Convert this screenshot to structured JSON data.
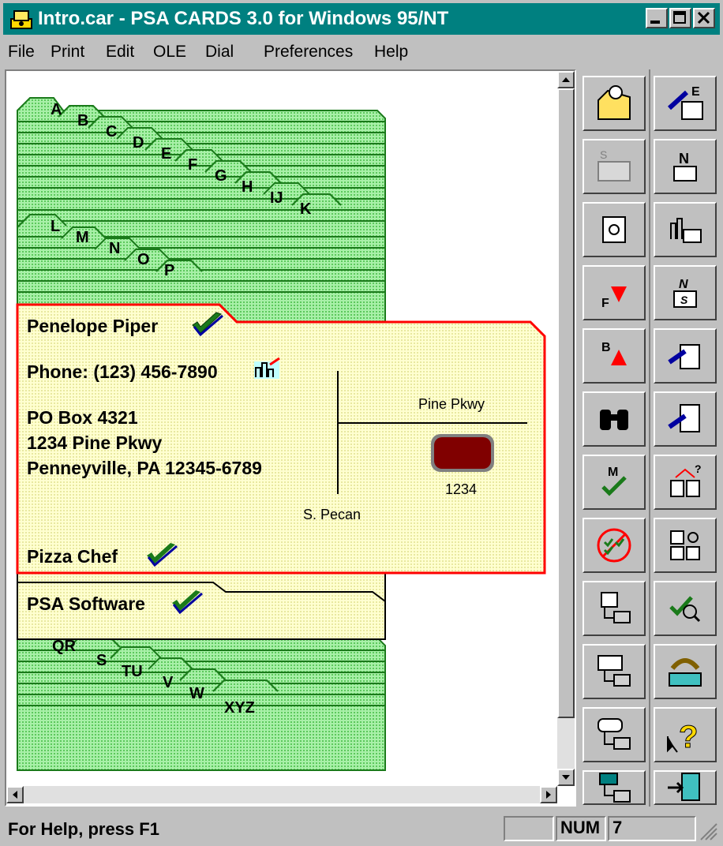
{
  "window": {
    "title": "Intro.car - PSA CARDS 3.0 for Windows 95/NT"
  },
  "menu": [
    {
      "label": "File"
    },
    {
      "label": "Print"
    },
    {
      "label": "Edit"
    },
    {
      "label": "OLE"
    },
    {
      "label": "Dial"
    },
    {
      "label": "Preferences"
    },
    {
      "label": "Help"
    }
  ],
  "tabs_top": [
    "A",
    "B",
    "C",
    "D",
    "E",
    "F",
    "G",
    "H",
    "IJ",
    "K"
  ],
  "tabs_mid": [
    "L",
    "M",
    "N",
    "O",
    "P"
  ],
  "tabs_bottom": [
    "QR",
    "S",
    "TU",
    "V",
    "W",
    "XYZ"
  ],
  "card": {
    "name": "Penelope Piper",
    "phone": "Phone: (123) 456-7890",
    "address_line1": "PO Box 4321",
    "address_line2": "1234 Pine Pkwy",
    "address_line3": "Penneyville, PA  12345-6789"
  },
  "map": {
    "street_h": "Pine Pkwy",
    "street_v": "S. Pecan",
    "house_number": "1234"
  },
  "cards_below": [
    {
      "name": "Pizza Chef"
    },
    {
      "name": "PSA Software"
    }
  ],
  "toolbar_icons": [
    "open-folder-icon",
    "edit-card-icon",
    "save-disabled-icon",
    "new-card-icon",
    "safe-icon",
    "city-card-icon",
    "find-forward-icon",
    "name-switch-icon",
    "find-backward-icon",
    "hand-card-icon",
    "binoculars-icon",
    "hand-document-icon",
    "mark-check-icon",
    "compare-cards-icon",
    "unmark-all-icon",
    "search-cards-icon",
    "print-card-icon",
    "find-check-icon",
    "print-envelope-icon",
    "dial-phone-icon",
    "print-label-icon",
    "help-pointer-icon",
    "print-book-icon",
    "exit-door-icon"
  ],
  "status": {
    "help": "For Help, press F1",
    "num": "NUM",
    "count": "7"
  },
  "colors": {
    "titlebar": "#008080",
    "tab_green": "#8fe08f",
    "card_yellow": "#ffffc8",
    "card_border": "#ff0000",
    "house": "#800000"
  }
}
